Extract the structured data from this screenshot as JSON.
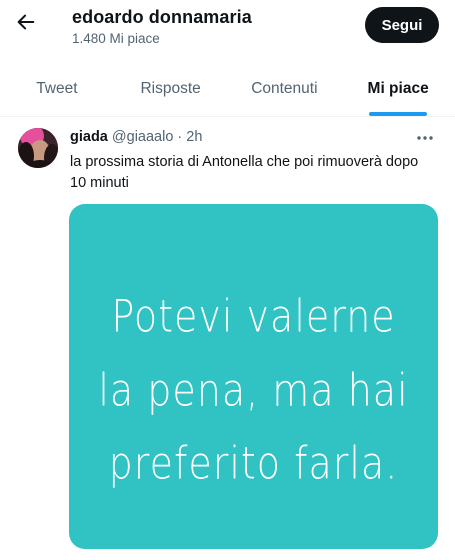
{
  "header": {
    "back_icon": "arrow-left-icon",
    "profile_name": "edoardo donnamaria",
    "likes_count": "1.480 Mi piace",
    "follow_label": "Segui"
  },
  "tabs": [
    {
      "label": "Tweet",
      "active": false
    },
    {
      "label": "Risposte",
      "active": false
    },
    {
      "label": "Contenuti",
      "active": false
    },
    {
      "label": "Mi piace",
      "active": true
    }
  ],
  "tweet": {
    "author_name": "giada",
    "author_handle": "@giaaalo",
    "separator": "·",
    "time": "2h",
    "text": "la prossima storia di Antonella che poi rimuoverà dopo 10 minuti",
    "more_icon": "more-horizontal-icon",
    "media": {
      "background": "#31c2c3",
      "lines": [
        "Potevi valerne",
        "la pena, ma hai",
        "preferito farla."
      ]
    }
  },
  "colors": {
    "accent": "#1d9bf0",
    "text_primary": "#0f1419",
    "text_secondary": "#536471",
    "follow_button": "#0f1419"
  }
}
